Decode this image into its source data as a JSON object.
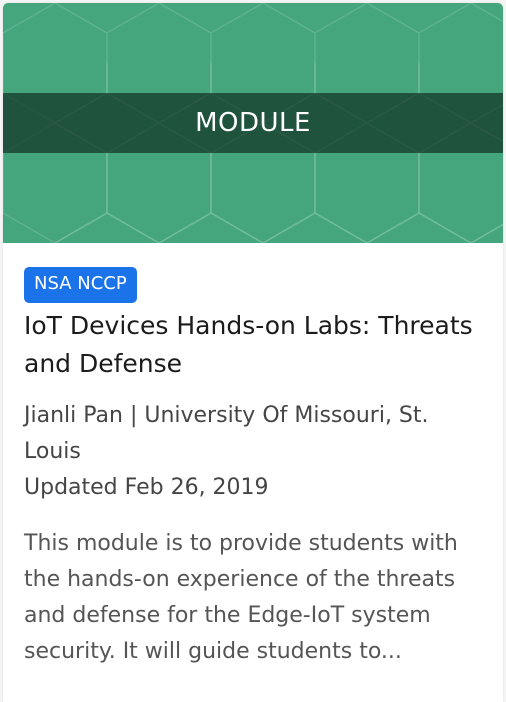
{
  "card": {
    "banner_label": "MODULE",
    "badge": "NSA NCCP",
    "title": "IoT Devices Hands-on Labs: Threats and Defense",
    "author_line": "Jianli Pan | University Of Missouri, St. Louis",
    "updated": "Updated Feb 26, 2019",
    "description": "This module is to provide students with the hands-on experience of the threats and defense for the Edge-IoT system security. It will guide students to..."
  },
  "colors": {
    "banner": "#45a67e",
    "banner_strip": "#1e4a37",
    "badge": "#1a73e8"
  }
}
